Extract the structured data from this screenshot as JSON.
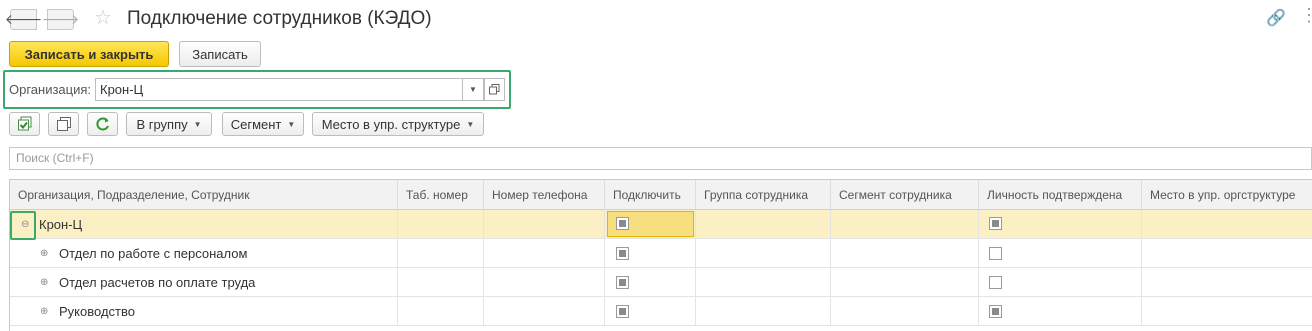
{
  "window": {
    "title": "Подключение сотрудников (КЭДО)",
    "back_glyph": "🡐",
    "forward_glyph": "🡒",
    "star_glyph": "☆",
    "link_glyph": "🔗",
    "more_glyph": "⋮"
  },
  "command_bar": {
    "save_close_label": "Записать и закрыть",
    "save_label": "Записать"
  },
  "organization": {
    "label": "Организация:",
    "value": "Крон-Ц"
  },
  "toolbar": {
    "group_label": "В группу",
    "segment_label": "Сегмент",
    "place_label": "Место в упр. структуре"
  },
  "search": {
    "placeholder": "Поиск (Ctrl+F)"
  },
  "table": {
    "columns": [
      "Организация, Подразделение, Сотрудник",
      "Таб. номер",
      "Номер телефона",
      "Подключить",
      "Группа сотрудника",
      "Сегмент сотрудника",
      "Личность подтверждена",
      "Место в упр. оргструктуре"
    ],
    "rows": [
      {
        "name": "Крон-Ц",
        "expander": "⊖",
        "connect": true,
        "identity": true
      },
      {
        "name": "Отдел по работе с персоналом",
        "expander": "⊕",
        "connect": true,
        "identity": false
      },
      {
        "name": "Отдел расчетов по оплате труда",
        "expander": "⊕",
        "connect": true,
        "identity": false
      },
      {
        "name": "Руководство",
        "expander": "⊕",
        "connect": true,
        "identity": true
      }
    ]
  },
  "colors": {
    "accent_primary": "#f6c700",
    "highlight_frame": "#3aaa6c",
    "selected_row": "#fbf0c4"
  }
}
